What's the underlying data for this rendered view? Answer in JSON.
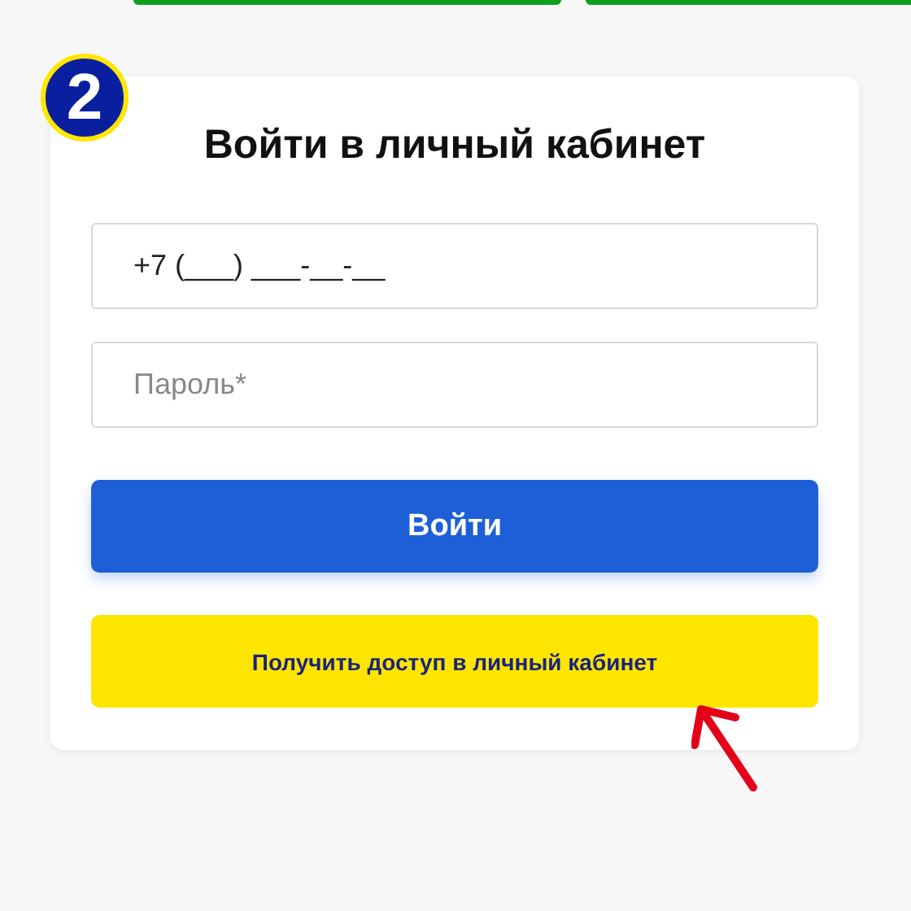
{
  "top_buttons": [
    {
      "kind": "green"
    },
    {
      "kind": "green"
    }
  ],
  "step_badge": "2",
  "form": {
    "title": "Войти в личный кабинет",
    "phone": {
      "value": "+7 (___) ___-__-__"
    },
    "password": {
      "placeholder": "Пароль*"
    },
    "buttons": [
      {
        "label": "Войти",
        "kind": "primary"
      },
      {
        "label": "Получить доступ в личный кабинет",
        "kind": "accent"
      }
    ]
  },
  "annotation": {
    "kind": "arrow"
  }
}
